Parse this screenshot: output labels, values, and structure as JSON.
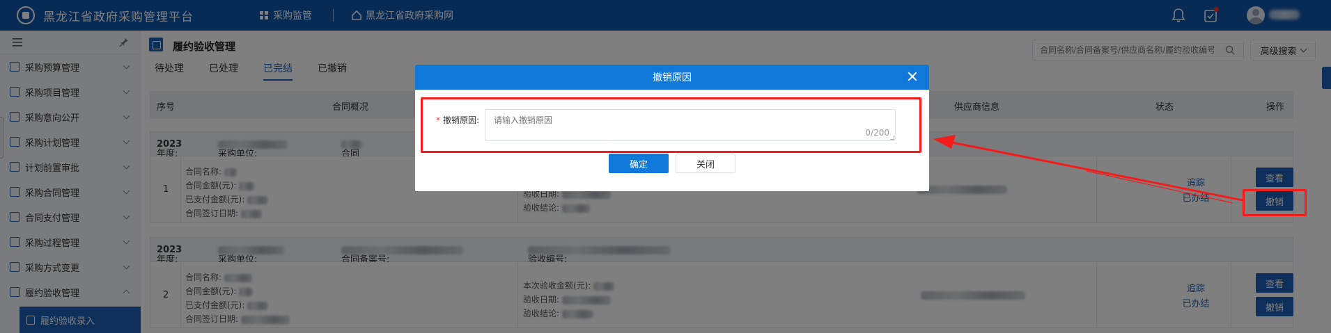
{
  "header": {
    "brand": "黑龙江省政府采购管理平台",
    "nav": [
      "采购监管",
      "黑龙江省政府采购网"
    ]
  },
  "sidebar": {
    "items": [
      {
        "label": "采购预算管理",
        "icon": "chart-icon"
      },
      {
        "label": "采购项目管理",
        "icon": "folder-icon"
      },
      {
        "label": "采购意向公开",
        "icon": "announce-icon"
      },
      {
        "label": "采购计划管理",
        "icon": "plan-icon"
      },
      {
        "label": "计划前置审批",
        "icon": "approve-icon"
      },
      {
        "label": "采购合同管理",
        "icon": "contract-icon"
      },
      {
        "label": "合同支付管理",
        "icon": "payment-icon"
      },
      {
        "label": "采购过程管理",
        "icon": "process-icon"
      },
      {
        "label": "采购方式变更",
        "icon": "switch-icon"
      },
      {
        "label": "履约验收管理",
        "icon": "acceptance-icon"
      }
    ],
    "sub_item": "履约验收录入"
  },
  "page": {
    "title": "履约验收管理",
    "tabs": [
      "待处理",
      "已处理",
      "已完结",
      "已撤销"
    ],
    "active_tab": 2,
    "search_placeholder": "合同名称/合同备案号/供应商名称/履约验收编号",
    "advanced_search": "高级搜索"
  },
  "table": {
    "headers": [
      "序号",
      "合同概况",
      "供应商信息",
      "状态",
      "操作"
    ],
    "group_labels": {
      "year": "年度:",
      "unit": "采购单位:",
      "record_no": "合同备案号:",
      "accept_no": "验收编号:"
    },
    "rows": [
      {
        "seq": "1",
        "year": "2023",
        "info": [
          "合同名称:",
          "合同金额(元):",
          "已支付金额(元):",
          "合同签订日期:"
        ],
        "accept": [
          "验收日期:",
          "验收结论:"
        ],
        "status_link": "追踪",
        "status": "已办结",
        "actions": [
          "查看",
          "撤销"
        ]
      },
      {
        "seq": "2",
        "year": "2023",
        "info": [
          "合同名称:",
          "合同金额(元):",
          "已支付金额(元):",
          "合同签订日期:"
        ],
        "accept": [
          "本次验收金额(元):",
          "验收日期:",
          "验收结论:"
        ],
        "status_link": "追踪",
        "status": "已办结",
        "actions": [
          "查看",
          "撤销"
        ]
      }
    ]
  },
  "dialog": {
    "title": "撤销原因",
    "field_label": "撤销原因:",
    "required_mark": "*",
    "placeholder": "请输入撤销原因",
    "counter": "0/200",
    "confirm": "确定",
    "close": "关闭"
  },
  "colors": {
    "header_bg": "#0f56a8",
    "primary": "#1a5fb4",
    "dialog_head": "#0f78d9",
    "annotation_red": "#f41b1b"
  }
}
